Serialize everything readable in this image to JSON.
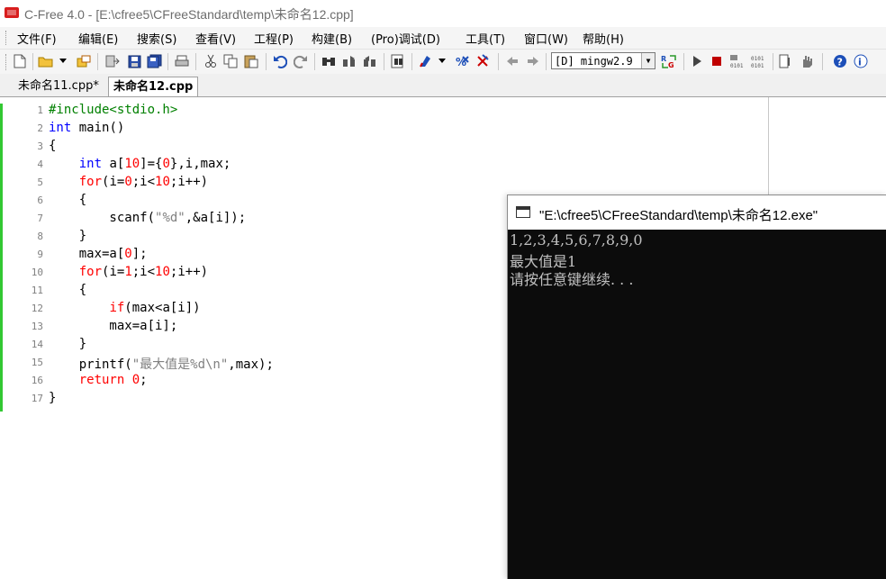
{
  "window": {
    "title": "C-Free 4.0 - [E:\\cfree5\\CFreeStandard\\temp\\未命名12.cpp]"
  },
  "menu": [
    "文件(F)",
    "编辑(E)",
    "搜索(S)",
    "查看(V)",
    "工程(P)",
    "构建(B)",
    "(Pro)调试(D)",
    "工具(T)",
    "窗口(W)",
    "帮助(H)"
  ],
  "toolbar": {
    "compiler": "[D] mingw2.9"
  },
  "tabs": [
    {
      "label": "未命名11.cpp*",
      "active": false
    },
    {
      "label": "未命名12.cpp",
      "active": true
    }
  ],
  "code": [
    {
      "n": "1",
      "t": "#include<stdio.h>"
    },
    {
      "n": "2",
      "t": "int main()"
    },
    {
      "n": "3",
      "t": "{"
    },
    {
      "n": "4",
      "t": "    int a[10]={0},i,max;"
    },
    {
      "n": "5",
      "t": "    for(i=0;i<10;i++)"
    },
    {
      "n": "6",
      "t": "    {"
    },
    {
      "n": "7",
      "t": "        scanf(\"%d\",&a[i]);"
    },
    {
      "n": "8",
      "t": "    }"
    },
    {
      "n": "9",
      "t": "    max=a[0];"
    },
    {
      "n": "10",
      "t": "    for(i=1;i<10;i++)"
    },
    {
      "n": "11",
      "t": "    {"
    },
    {
      "n": "12",
      "t": "        if(max<a[i])"
    },
    {
      "n": "13",
      "t": "        max=a[i];"
    },
    {
      "n": "14",
      "t": "    }"
    },
    {
      "n": "15",
      "t": "    printf(\"最大值是%d\\n\",max);"
    },
    {
      "n": "16",
      "t": "    return 0;"
    },
    {
      "n": "17",
      "t": "}"
    }
  ],
  "console": {
    "title": "\"E:\\cfree5\\CFreeStandard\\temp\\未命名12.exe\"",
    "lines": [
      "1,2,3,4,5,6,7,8,9,0",
      "最大值是1",
      "请按任意键继续. . ."
    ]
  },
  "colors": {
    "preprocessor": "#008000",
    "type_keyword": "#0000ff",
    "control_keyword": "#ff0000",
    "number": "#ff0000",
    "string": "#808080",
    "modified_bar": "#32c832",
    "console_bg": "#0c0c0c",
    "console_text": "#c0c0c0"
  }
}
